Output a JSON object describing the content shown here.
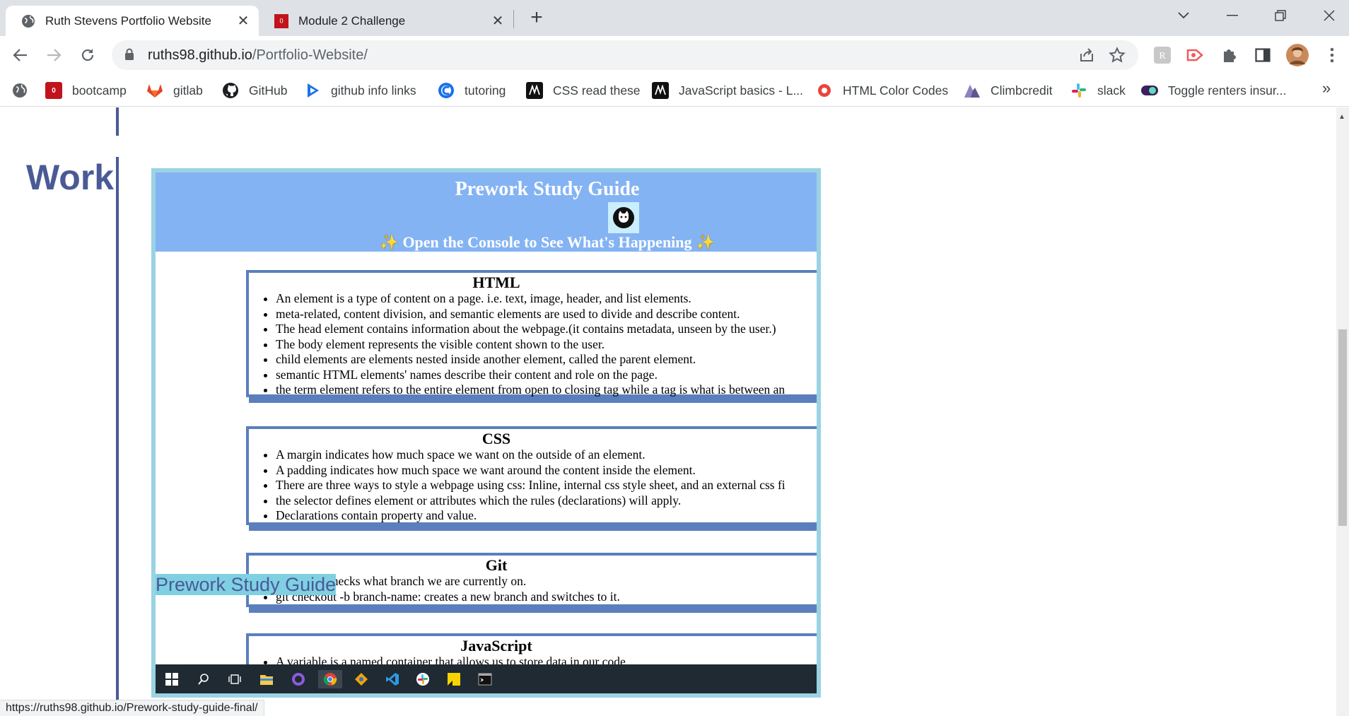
{
  "browser": {
    "tabs": [
      {
        "title": "Ruth Stevens Portfolio Website",
        "active": true,
        "icon": "globe-icon"
      },
      {
        "title": "Module 2 Challenge",
        "active": false,
        "icon": "bootcamp-icon"
      }
    ],
    "url_host": "ruths98.github.io",
    "url_path": "/Portfolio-Website/",
    "status_url": "https://ruths98.github.io/Prework-study-guide-final/"
  },
  "bookmarks": [
    {
      "label": "bootcamp",
      "icon": "bootcamp-icon"
    },
    {
      "label": "gitlab",
      "icon": "gitlab-icon"
    },
    {
      "label": "GitHub",
      "icon": "github-icon"
    },
    {
      "label": "github info links",
      "icon": "play-icon"
    },
    {
      "label": "tutoring",
      "icon": "c-icon"
    },
    {
      "label": "CSS read these",
      "icon": "medium-icon"
    },
    {
      "label": "JavaScript basics - L...",
      "icon": "medium-icon"
    },
    {
      "label": "HTML Color Codes",
      "icon": "color-icon"
    },
    {
      "label": "Climbcredit",
      "icon": "climb-icon"
    },
    {
      "label": "slack",
      "icon": "slack-icon"
    },
    {
      "label": "Toggle renters insur...",
      "icon": "toggle-icon"
    }
  ],
  "page": {
    "section_heading": "Work",
    "project_link": "Prework Study Guide",
    "preview": {
      "title": "Prework Study Guide",
      "subtitle": "Open the Console to See What's Happening",
      "sections": [
        {
          "heading": "HTML",
          "items": [
            "An element is a type of content on a page. i.e. text, image, header, and list elements.",
            "meta-related, content division, and semantic elements are used to divide and describe content.",
            "The head element contains information about the webpage.(it contains metadata, unseen by the user.)",
            "The body element represents the visible content shown to the user.",
            "child elements are elements nested inside another element, called the parent element.",
            "semantic HTML elements' names describe their content and role on the page.",
            "the term element refers to the entire element from open to closing tag while a tag is what is between an"
          ]
        },
        {
          "heading": "CSS",
          "items": [
            "A margin indicates how much space we want on the outside of an element.",
            "A padding indicates how much space we want around the content inside the element.",
            "There are three ways to style a webpage using css: Inline, internal css style sheet, and an external css fi",
            "the selector defines element or attributes which the rules (declarations) will apply.",
            "Declarations contain property and value."
          ]
        },
        {
          "heading": "Git",
          "items": [
            "git status: checks what branch we are currently on.",
            "git checkout -b branch-name: creates a new branch and switches to it."
          ]
        },
        {
          "heading": "JavaScript",
          "items": [
            "A variable is a named container that allows us to store data in our code."
          ]
        }
      ]
    }
  },
  "colors": {
    "accent": "#4a5a96",
    "preview_border": "#9ad3e3",
    "preview_header": "#84b3f3",
    "card_border": "#5b7fbd"
  }
}
